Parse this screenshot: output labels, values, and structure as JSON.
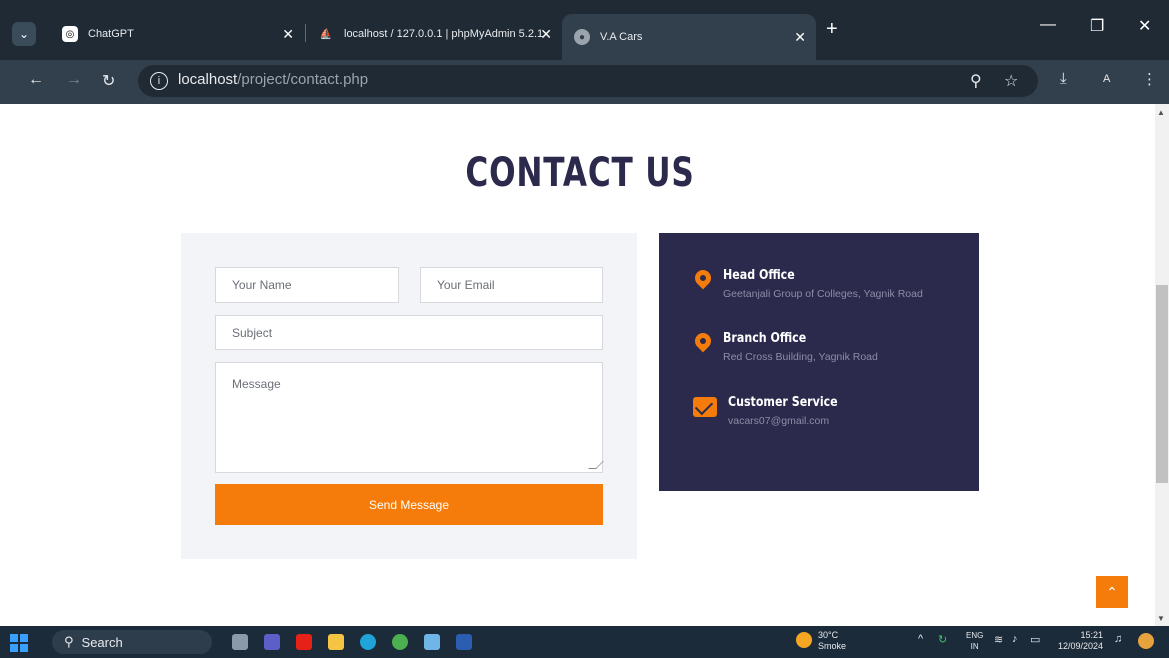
{
  "browser": {
    "tabs": [
      {
        "title": "ChatGPT"
      },
      {
        "title": "localhost / 127.0.0.1 | phpMyAdmin 5.2.1"
      },
      {
        "title": "V.A Cars"
      }
    ],
    "url_host": "localhost",
    "url_path": "/project/contact.php"
  },
  "page": {
    "title": "CONTACT US",
    "form": {
      "name_placeholder": "Your Name",
      "email_placeholder": "Your Email",
      "subject_placeholder": "Subject",
      "message_placeholder": "Message",
      "submit_label": "Send Message"
    },
    "info": [
      {
        "icon": "map-pin-icon",
        "heading": "Head Office",
        "detail": "Geetanjali Group of Colleges, Yagnik Road"
      },
      {
        "icon": "map-pin-icon",
        "heading": "Branch Office",
        "detail": "Red Cross Building, Yagnik Road"
      },
      {
        "icon": "envelope-open-icon",
        "heading": "Customer Service",
        "detail": "vacars07@gmail.com"
      }
    ]
  },
  "taskbar": {
    "search_label": "Search",
    "weather_temp": "30°C",
    "weather_desc": "Smoke",
    "lang_top": "ENG",
    "lang_bottom": "IN",
    "time": "15:21",
    "date": "12/09/2024"
  },
  "colors": {
    "accent": "#f57c0a",
    "navy": "#2b2a4c",
    "form_bg": "#f3f4f8"
  }
}
